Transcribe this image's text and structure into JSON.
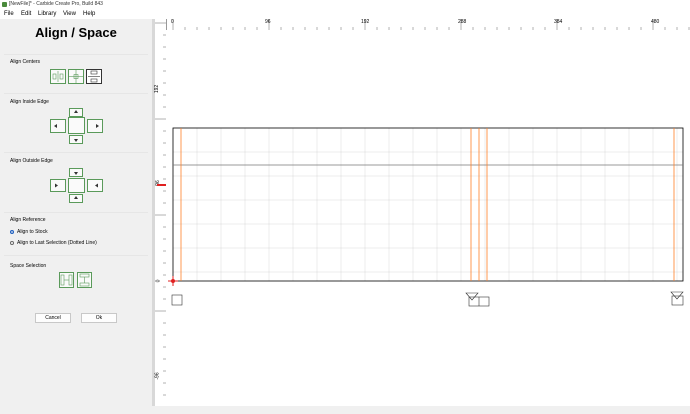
{
  "window": {
    "title": "[NewFile]* - Carbide Create Pro, Build 843"
  },
  "menu": {
    "items": [
      "File",
      "Edit",
      "Library",
      "View",
      "Help"
    ]
  },
  "panel": {
    "title": "Align / Space",
    "align_centers_label": "Align Centers",
    "align_inside_label": "Align Inside Edge",
    "align_outside_label": "Align Outside Edge",
    "align_reference_label": "Align Reference",
    "radio_stock_label": "Align to Stock",
    "radio_last_label": "Align to Last Selection (Dotted Line)",
    "radio_selected": "stock",
    "space_selection_label": "Space Selection",
    "cancel_label": "Cancel",
    "ok_label": "Ok"
  },
  "rulers": {
    "top_ticks": [
      "0",
      "96",
      "192",
      "288",
      "384",
      "480"
    ],
    "left_ticks": [
      "192",
      "96",
      "0",
      "-96"
    ]
  },
  "colors": {
    "toolpath_orange": "#ff7f27",
    "stock_outline": "#000000",
    "origin_marker": "#e02020",
    "grid": "#d9d9d9",
    "icon_green": "#5a9a5a"
  }
}
